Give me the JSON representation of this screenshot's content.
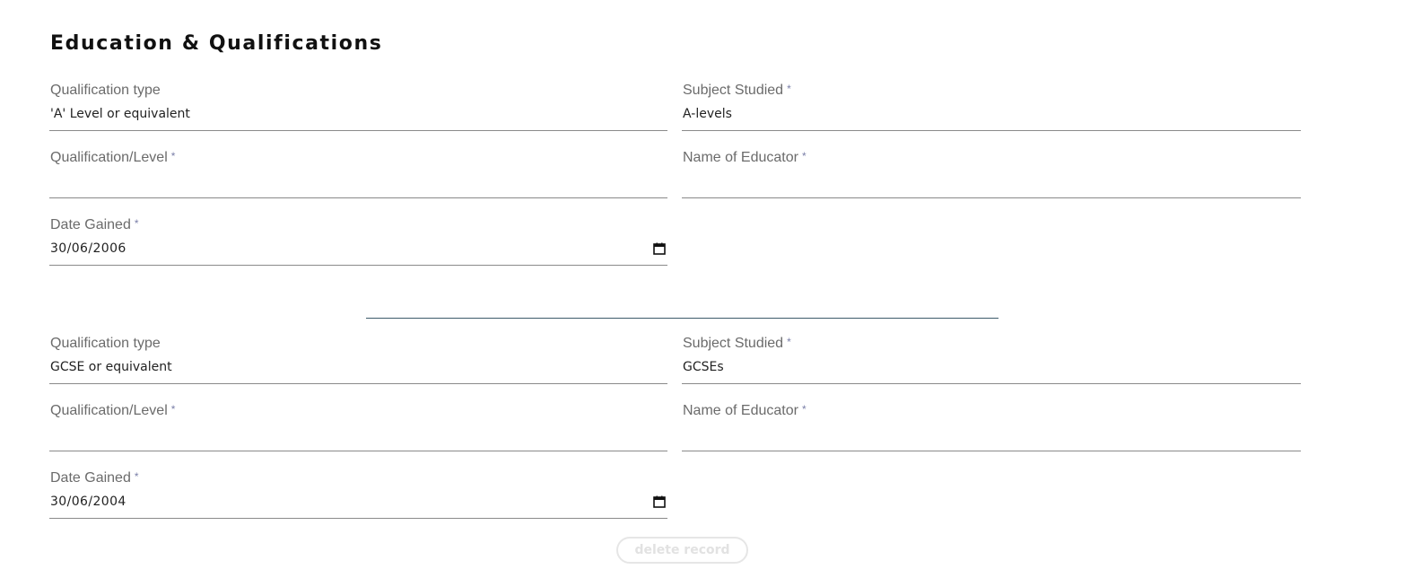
{
  "section_title": "Education & Qualifications",
  "required_marker": "*",
  "records": [
    {
      "qualification_type": {
        "label": "Qualification type",
        "value": "'A' Level or equivalent"
      },
      "subject_studied": {
        "label": "Subject Studied",
        "value": "A-levels"
      },
      "qualification_level": {
        "label": "Qualification/Level",
        "value": ""
      },
      "name_of_educator": {
        "label": "Name of Educator",
        "value": ""
      },
      "date_gained": {
        "label": "Date Gained",
        "value": "30/06/2006"
      }
    },
    {
      "qualification_type": {
        "label": "Qualification type",
        "value": "GCSE or equivalent"
      },
      "subject_studied": {
        "label": "Subject Studied",
        "value": "GCSEs"
      },
      "qualification_level": {
        "label": "Qualification/Level",
        "value": ""
      },
      "name_of_educator": {
        "label": "Name of Educator",
        "value": ""
      },
      "date_gained": {
        "label": "Date Gained",
        "value": "30/06/2004"
      }
    }
  ],
  "delete_button_label": "delete record",
  "icons": {
    "date_picker": "calendar-icon"
  },
  "colors": {
    "required_marker": "#7a7fa8",
    "divider": "#3d5a6b",
    "label": "#6b6b6b"
  }
}
